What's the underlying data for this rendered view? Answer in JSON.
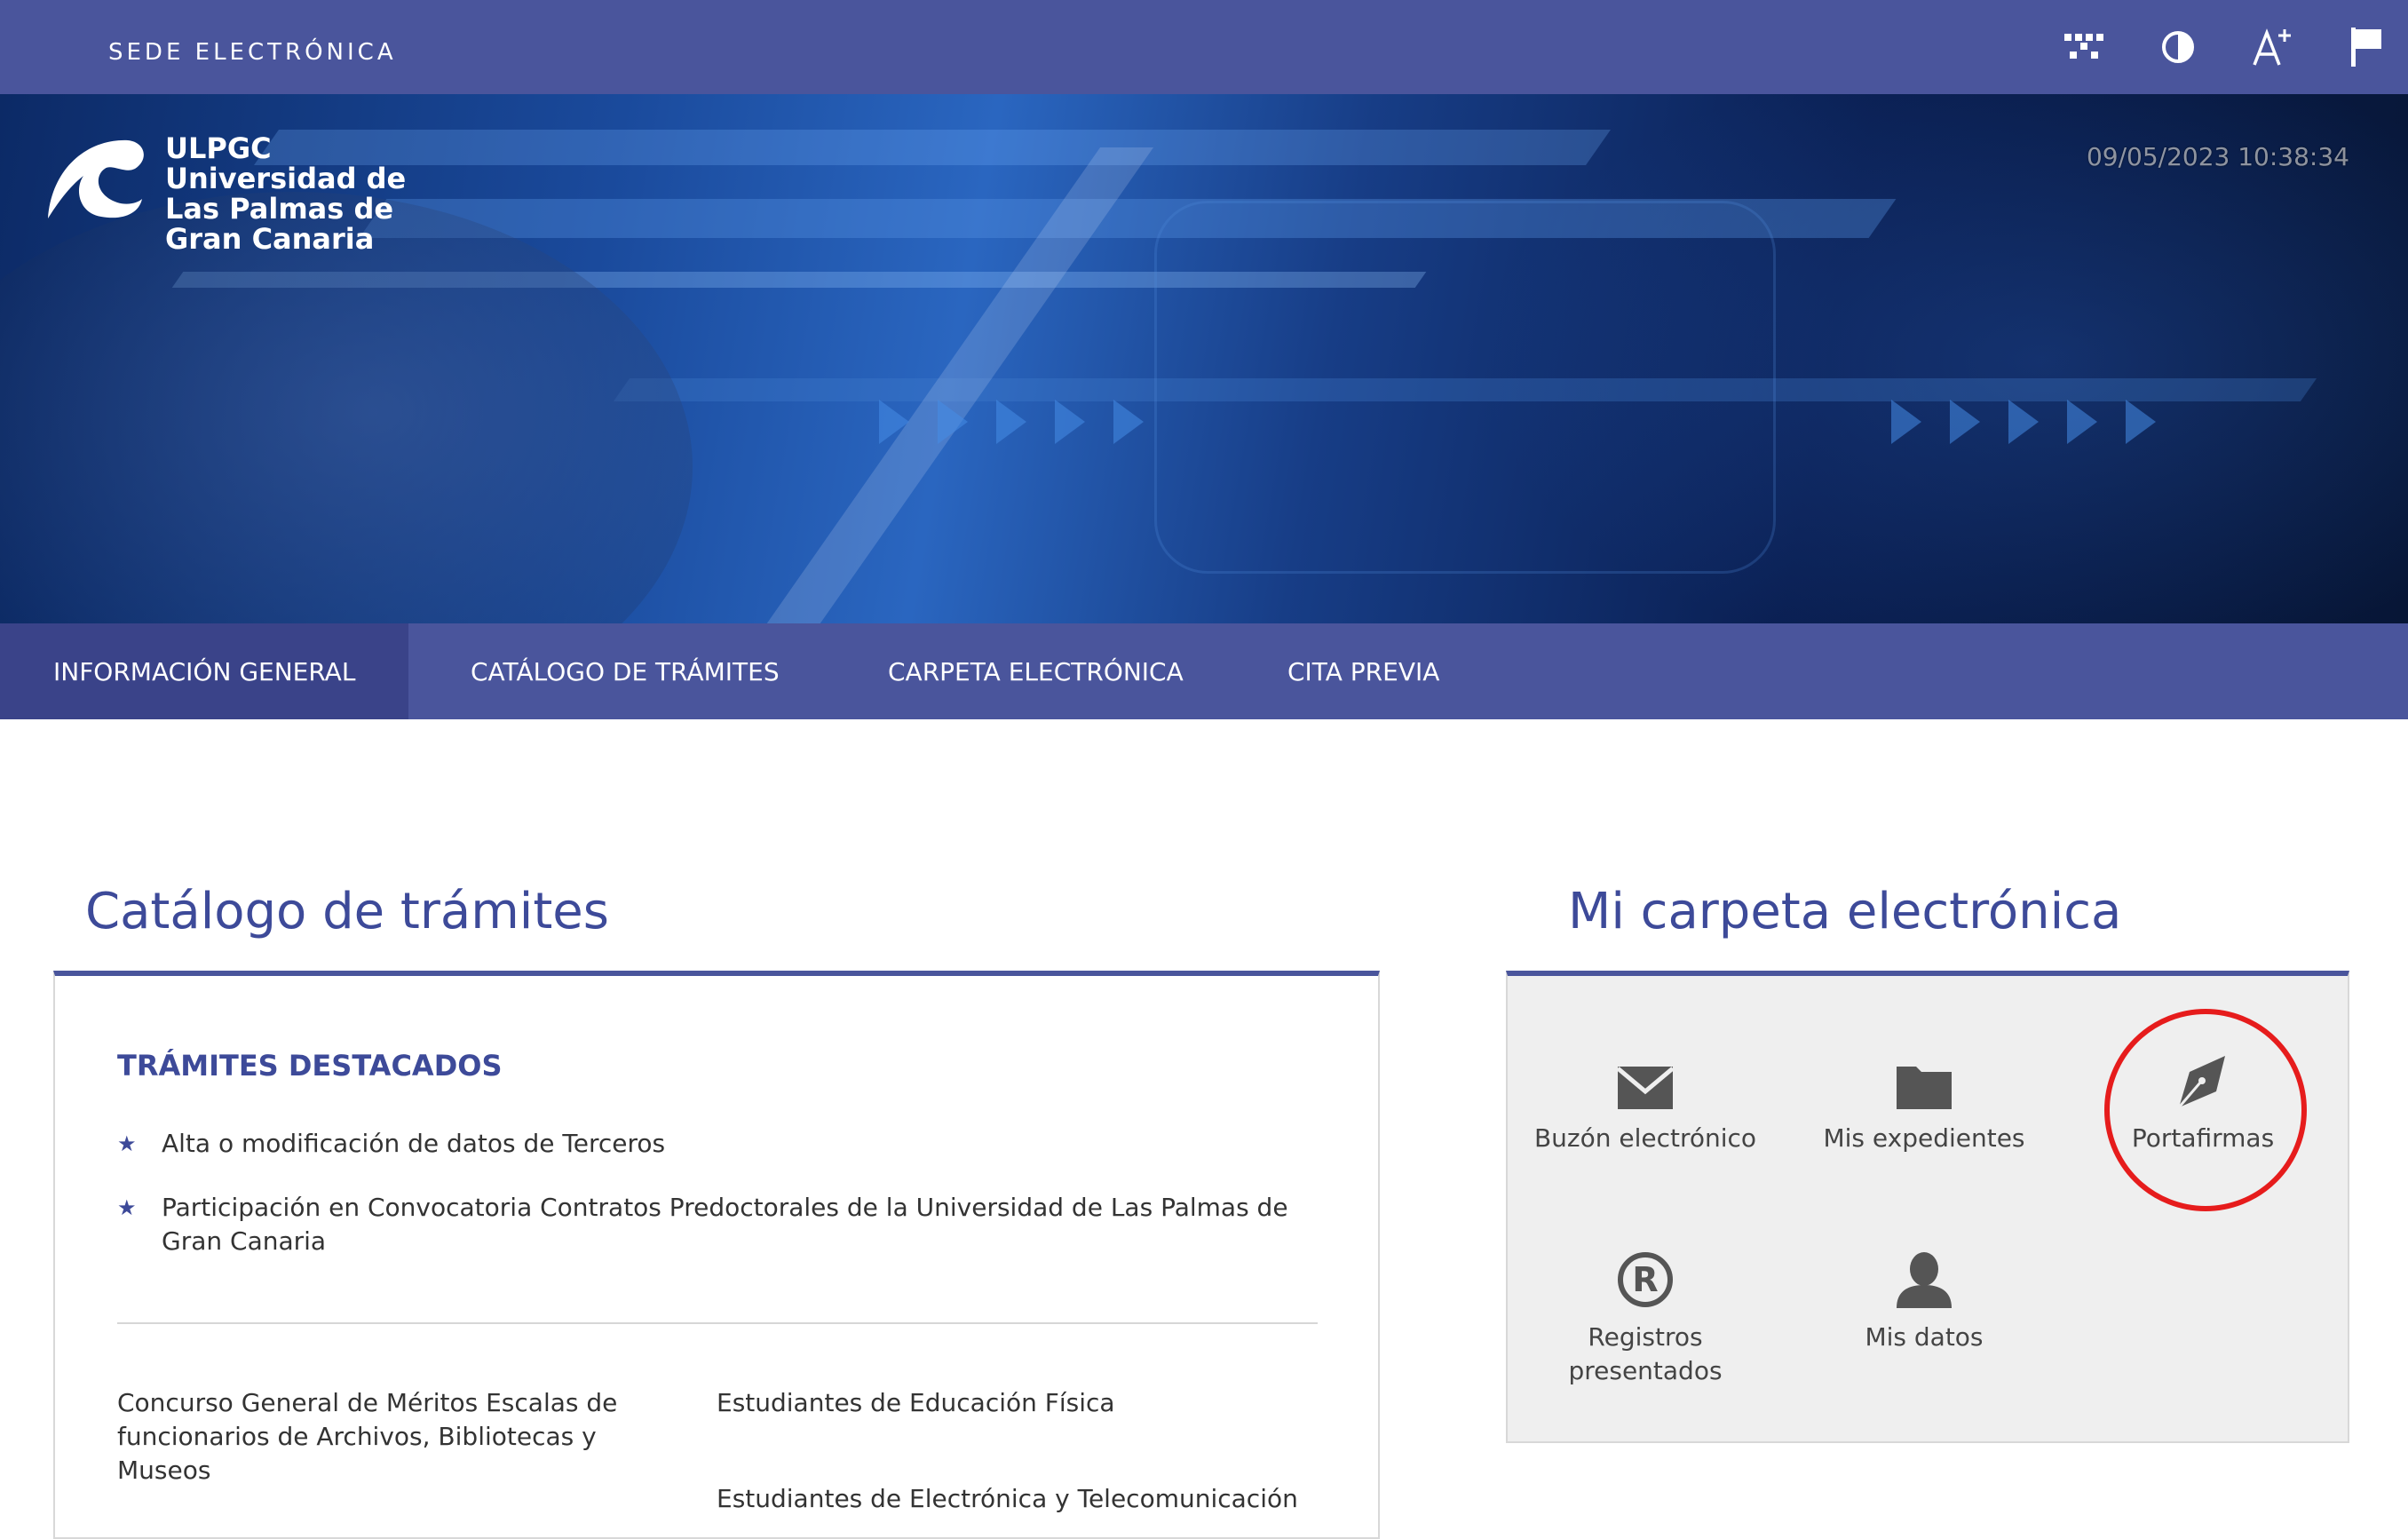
{
  "topbar": {
    "title": "SEDE ELECTRÓNICA",
    "tools": [
      {
        "name": "sitemap-icon"
      },
      {
        "name": "contrast-icon"
      },
      {
        "name": "font-size-icon"
      },
      {
        "name": "language-flag-icon"
      }
    ]
  },
  "hero": {
    "logo_lines": [
      "ULPGC",
      "Universidad de",
      "Las Palmas de",
      "Gran Canaria"
    ],
    "datetime": "09/05/2023 10:38:34"
  },
  "nav": {
    "items": [
      {
        "label": "INFORMACIÓN GENERAL",
        "active": true
      },
      {
        "label": "CATÁLOGO DE TRÁMITES",
        "active": false
      },
      {
        "label": "CARPETA ELECTRÓNICA",
        "active": false
      },
      {
        "label": "CITA PREVIA",
        "active": false
      }
    ]
  },
  "catalog": {
    "title": "Catálogo de trámites",
    "featured_heading": "TRÁMITES DESTACADOS",
    "featured": [
      "Alta o modificación de datos de Terceros",
      "Participación en Convocatoria Contratos Predoctorales de la Universidad de Las Palmas de Gran Canaria"
    ],
    "procedures": [
      "Concurso General de Méritos Escalas de funcionarios de Archivos, Bibliotecas y Museos",
      "Estudiantes de Educación Física",
      "Estudiantes de Electrónica y Telecomunicación"
    ]
  },
  "folder": {
    "title": "Mi carpeta electrónica",
    "tiles": [
      {
        "label": "Buzón electrónico",
        "icon": "envelope-icon"
      },
      {
        "label": "Mis expedientes",
        "icon": "folder-icon"
      },
      {
        "label": "Portafirmas",
        "icon": "pen-nib-icon",
        "highlighted": true
      },
      {
        "label": "Registros presentados",
        "icon": "registered-icon"
      },
      {
        "label": "Mis datos",
        "icon": "user-icon"
      }
    ]
  },
  "colors": {
    "primary": "#4a559c",
    "primary_dark": "#3a4389",
    "heading": "#3d4a99",
    "highlight": "#e61c1c"
  }
}
